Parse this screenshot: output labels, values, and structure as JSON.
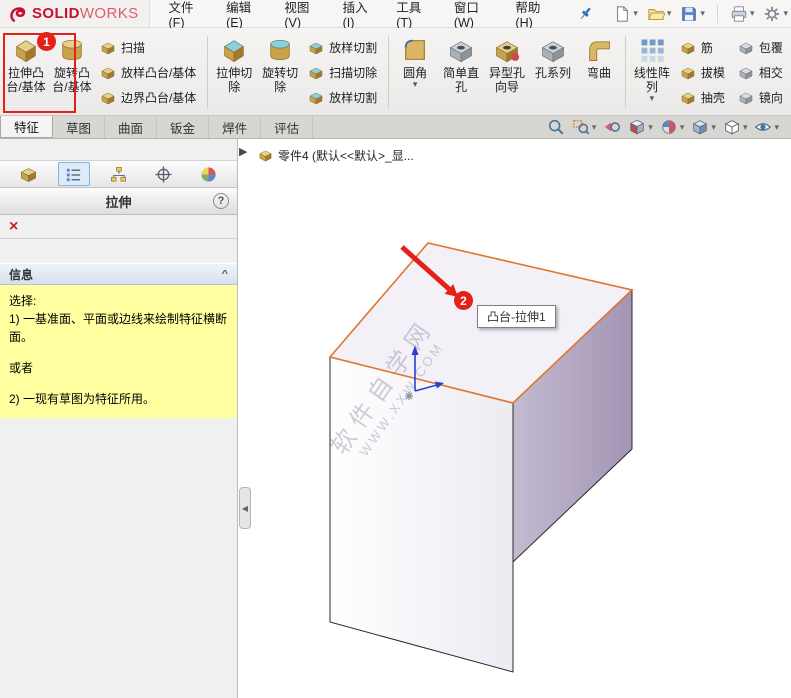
{
  "window": {
    "logo_solid": "SOLID",
    "logo_works": "WORKS"
  },
  "menu": {
    "items": [
      "文件(F)",
      "编辑(E)",
      "视图(V)",
      "插入(I)",
      "工具(T)",
      "窗口(W)",
      "帮助(H)"
    ]
  },
  "ribbon": {
    "big": [
      "拉伸凸台/基体",
      "旋转凸台/基体",
      "拉伸切除",
      "旋转切除",
      "圆角",
      "简单直孔",
      "异型孔向导",
      "孔系列",
      "弯曲",
      "线性阵列"
    ],
    "small": [
      [
        "扫描",
        "放样凸台/基体",
        "边界凸台/基体"
      ],
      [
        "放样切割",
        "扫描切除",
        "放样切割"
      ],
      [
        "筋",
        "拔模",
        "抽壳"
      ],
      [
        "包覆",
        "相交",
        "镜向"
      ]
    ]
  },
  "tabs": [
    "特征",
    "草图",
    "曲面",
    "钣金",
    "焊件",
    "评估"
  ],
  "panel": {
    "title": "拉伸",
    "help": "?",
    "close": "×",
    "group": "信息",
    "chevron": "^",
    "messages": [
      "选择:",
      "1) 一基准面、平面或边线来绘制特征横断面。",
      "或者",
      "2) 一现有草图为特征所用。"
    ]
  },
  "graphics": {
    "tree_label": "零件4 (默认<<默认>_显...",
    "tooltip": "凸台-拉伸1",
    "badge1": "1",
    "badge2": "2",
    "watermark_cn": "软件自学网",
    "watermark_en": "WWW.XXW.COM",
    "collapse_right": "▶",
    "collapse_left": "◀"
  },
  "icons": {
    "dropdown": "▾"
  },
  "colors": {
    "annotation_red": "#e32119",
    "selected_edge_orange": "#e0752b",
    "message_yellow": "#ffffa0",
    "logo_red": "#c8102e",
    "face_shaded": "#ab9fbc"
  }
}
